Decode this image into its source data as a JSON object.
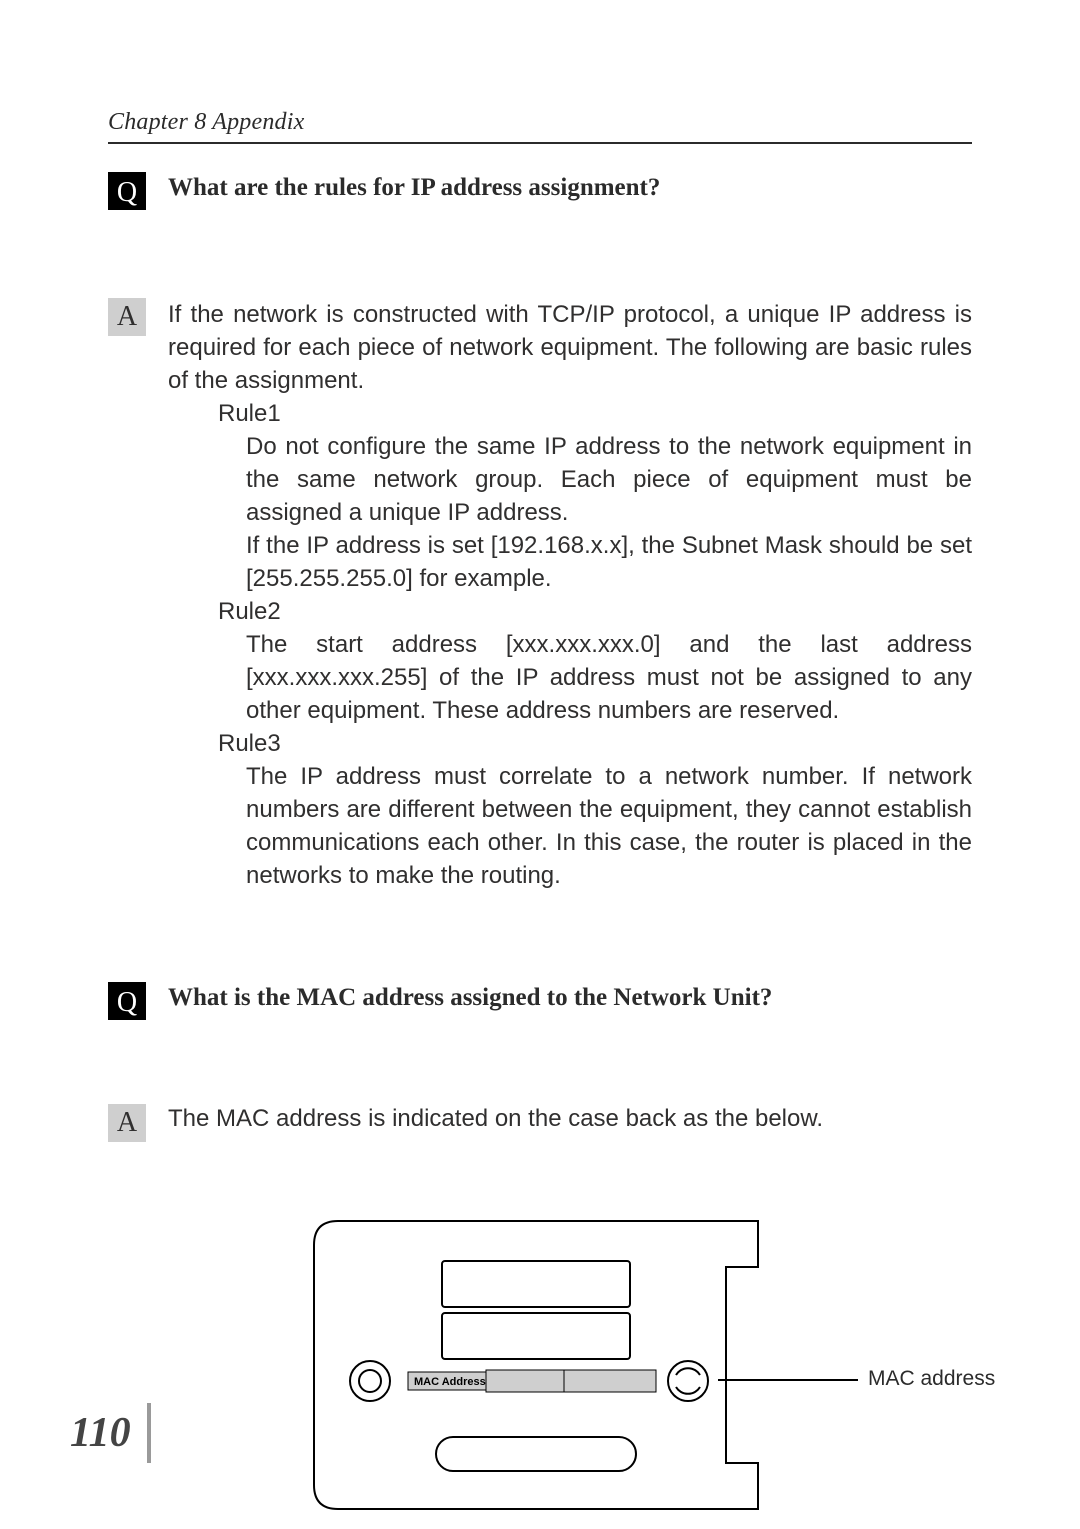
{
  "chapter": "Chapter 8 Appendix",
  "q1": {
    "badge": "Q",
    "text": "What are the rules for IP address assignment?"
  },
  "a1": {
    "badge": "A",
    "intro": "If the network is constructed with TCP/IP protocol, a unique IP address is required for each piece of network equipment. The following are basic rules of the assignment.",
    "rule1": {
      "label": "Rule1",
      "p1": "Do not configure the same IP address to the network equipment in the same network group. Each piece of equipment must be assigned a unique IP address.",
      "p2": "If the IP address is set [192.168.x.x], the Subnet Mask should be set [255.255.255.0] for example."
    },
    "rule2": {
      "label": "Rule2",
      "p1": "The start address [xxx.xxx.xxx.0] and the last address [xxx.xxx.xxx.255] of the IP address must not be assigned to any other equipment. These address numbers are reserved."
    },
    "rule3": {
      "label": "Rule3",
      "p1": "The IP address must correlate to a network number. If network numbers are different between the equipment, they cannot establish communica­tions each other. In this case, the router is placed in the networks to make the routing."
    }
  },
  "q2": {
    "badge": "Q",
    "text": "What is the MAC address assigned to the Network Unit?"
  },
  "a2": {
    "badge": "A",
    "text": "The MAC address is indicated on the case back as the below."
  },
  "diagram": {
    "mac_label_small": "MAC Address",
    "callout": "MAC address"
  },
  "page_number": "110"
}
